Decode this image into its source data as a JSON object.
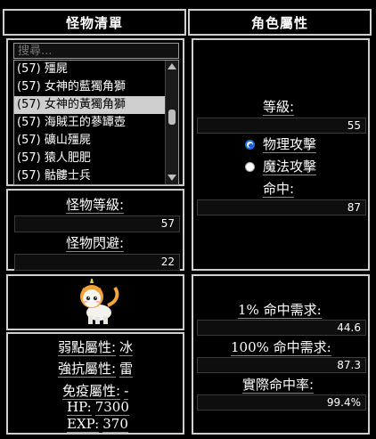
{
  "headers": {
    "monster_list": "怪物清單",
    "char_attrs": "角色屬性"
  },
  "search": {
    "placeholder": "搜尋..."
  },
  "monsters": [
    "(57) 殭屍",
    "(57) 女神的藍獨角獅",
    "(57) 女神的黃獨角獅",
    "(57) 海賊王的蔘罈壺",
    "(57) 礦山殭屍",
    "(57) 猿人肥肥",
    "(57) 骷髏士兵"
  ],
  "selected_index": 2,
  "monster_stats": {
    "level_label": "怪物等級:",
    "level_value": "57",
    "evasion_label": "怪物閃避:",
    "evasion_value": "22"
  },
  "monster_info": {
    "weak_label": "弱點屬性:",
    "weak_value": "冰",
    "resist_label": "強抗屬性:",
    "resist_value": "雷",
    "immune_label": "免疫屬性:",
    "immune_value": "-",
    "hp_label": "HP:",
    "hp_value": "7300",
    "exp_label": "EXP:",
    "exp_value": "370"
  },
  "char": {
    "level_label": "等級:",
    "level_value": "55",
    "attack_types": [
      "物理攻擊",
      "魔法攻擊"
    ],
    "attack_selected": 0,
    "accuracy_label": "命中:",
    "accuracy_value": "87"
  },
  "results": {
    "req1_label": "1% 命中需求:",
    "req1_value": "44.6",
    "req100_label": "100% 命中需求:",
    "req100_value": "87.3",
    "actual_label": "實際命中率:",
    "actual_value": "99.4%"
  }
}
